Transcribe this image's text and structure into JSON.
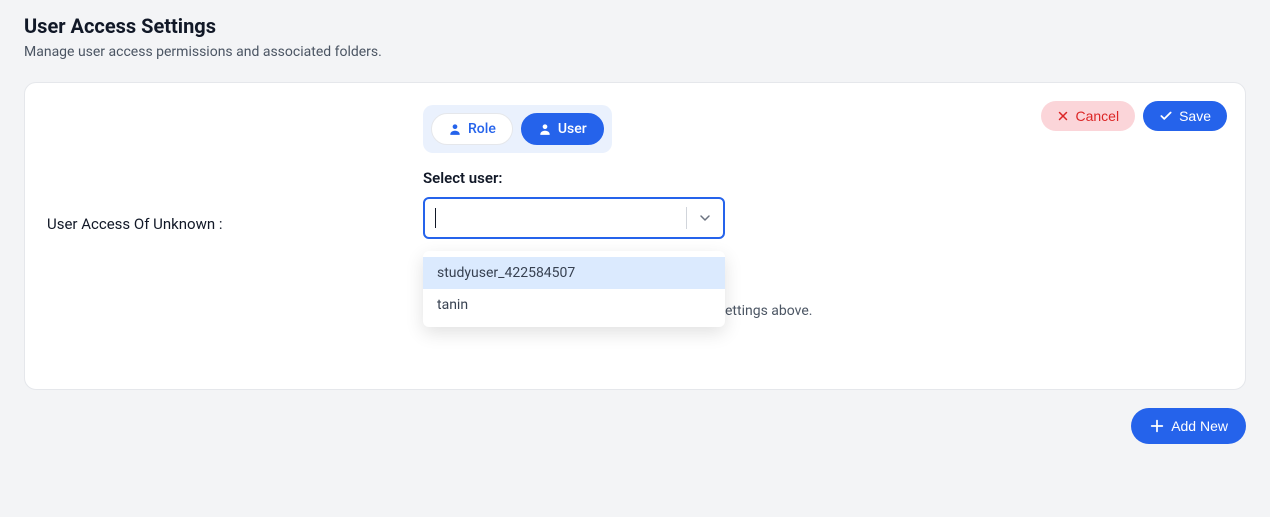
{
  "header": {
    "title": "User Access Settings",
    "subtitle": "Manage user access permissions and associated folders."
  },
  "card": {
    "cancel_label": "Cancel",
    "save_label": "Save",
    "left_label": "User Access Of Unknown :",
    "segmented": {
      "role_label": "Role",
      "user_label": "User"
    },
    "select": {
      "label": "Select user:",
      "options": [
        "studyuser_422584507",
        "tanin"
      ]
    },
    "hint_suffix": "s assigned in the Access Backend File Browser settings above."
  },
  "footer": {
    "addnew_label": "Add New"
  }
}
